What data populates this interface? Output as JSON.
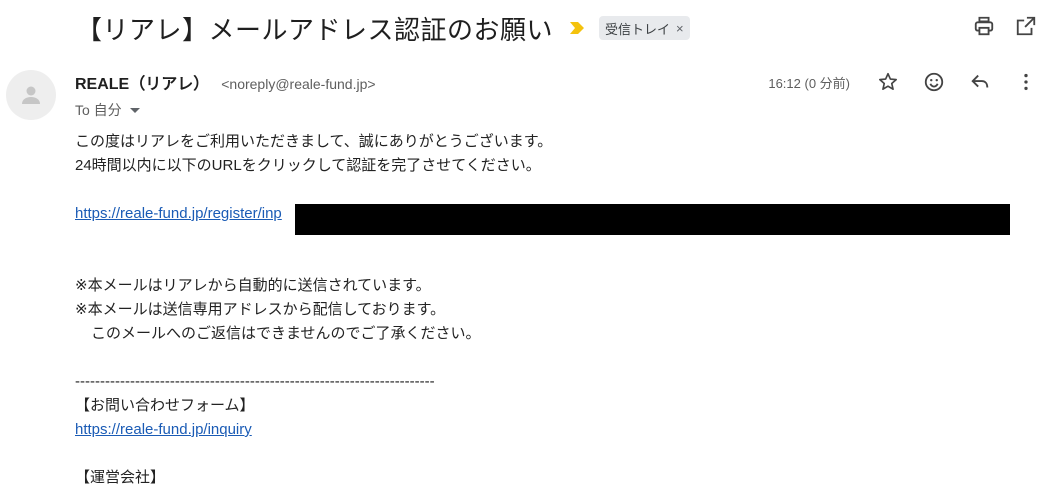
{
  "subject": "【リアレ】メールアドレス認証のお願い",
  "label_chip": {
    "text": "受信トレイ",
    "close": "×"
  },
  "icons": {
    "importance": "importance-marker-icon",
    "print": "print-icon",
    "open_new_window": "open-in-new-window-icon",
    "avatar": "person-avatar-icon",
    "star": "star-icon",
    "emoji": "emoji-reaction-icon",
    "reply": "reply-icon",
    "more": "more-vert-icon"
  },
  "colors": {
    "importance": "#f4c20d",
    "link": "#1a5bb5",
    "chip_bg": "#e8eaed"
  },
  "sender": {
    "name": "REALE（リアレ）",
    "email": "<noreply@reale-fund.jp>",
    "to": "To 自分",
    "time": "16:12 (0 分前)"
  },
  "body": {
    "line1": "この度はリアレをご利用いただきまして、誠にありがとうございます。",
    "line2": "24時間以内に以下のURLをクリックして認証を完了させてください。",
    "register_link": "https://reale-fund.jp/register/inp",
    "note1": "※本メールはリアレから自動的に送信されています。",
    "note2": "※本メールは送信専用アドレスから配信しております。",
    "note3": "このメールへのご返信はできませんのでご了承ください。",
    "divider": "------------------------------------------------------------------------",
    "inquiry_heading": "【お問い合わせフォーム】",
    "inquiry_link": "https://reale-fund.jp/inquiry",
    "company_heading": "【運営会社】"
  }
}
